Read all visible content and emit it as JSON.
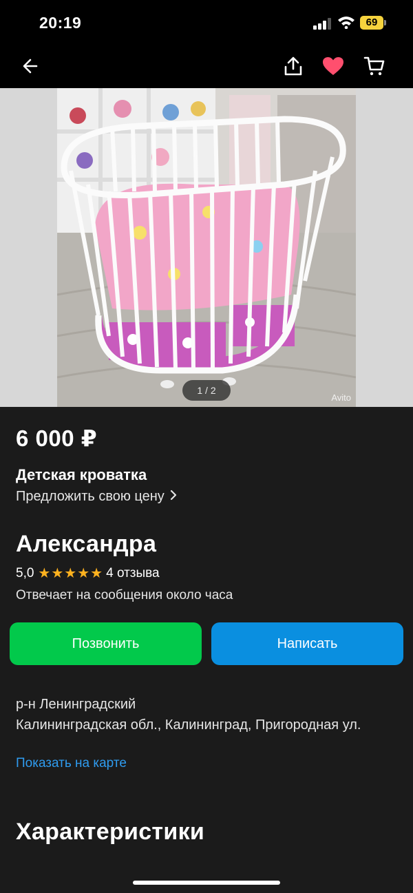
{
  "status_bar": {
    "time": "20:19",
    "battery_level": "69",
    "signal_bars_active": 3,
    "signal_bars_total": 4
  },
  "nav": {
    "icons": [
      "back-arrow-icon",
      "share-icon",
      "heart-icon",
      "cart-icon"
    ],
    "favorite_color": "#ff4f6e"
  },
  "gallery": {
    "counter": "1 / 2",
    "watermark": "Avito"
  },
  "listing": {
    "price": "6 000 ₽",
    "title": "Детская кроватка",
    "offer_price_label": "Предложить свою цену",
    "offer_chevron": "›"
  },
  "seller": {
    "name": "Александра",
    "rating": "5,0",
    "stars": 5,
    "reviews": "4 отзыва",
    "reply_time": "Отвечает на сообщения около часа"
  },
  "actions": {
    "call_label": "Позвонить",
    "message_label": "Написать",
    "call_color": "#02c94b",
    "message_color": "#0a8fe0"
  },
  "location": {
    "district": "р-н Ленинградский",
    "address": "Калининградская обл., Калининград, Пригородная ул.",
    "map_link": "Показать на карте"
  },
  "section": {
    "title": "Характеристики"
  }
}
